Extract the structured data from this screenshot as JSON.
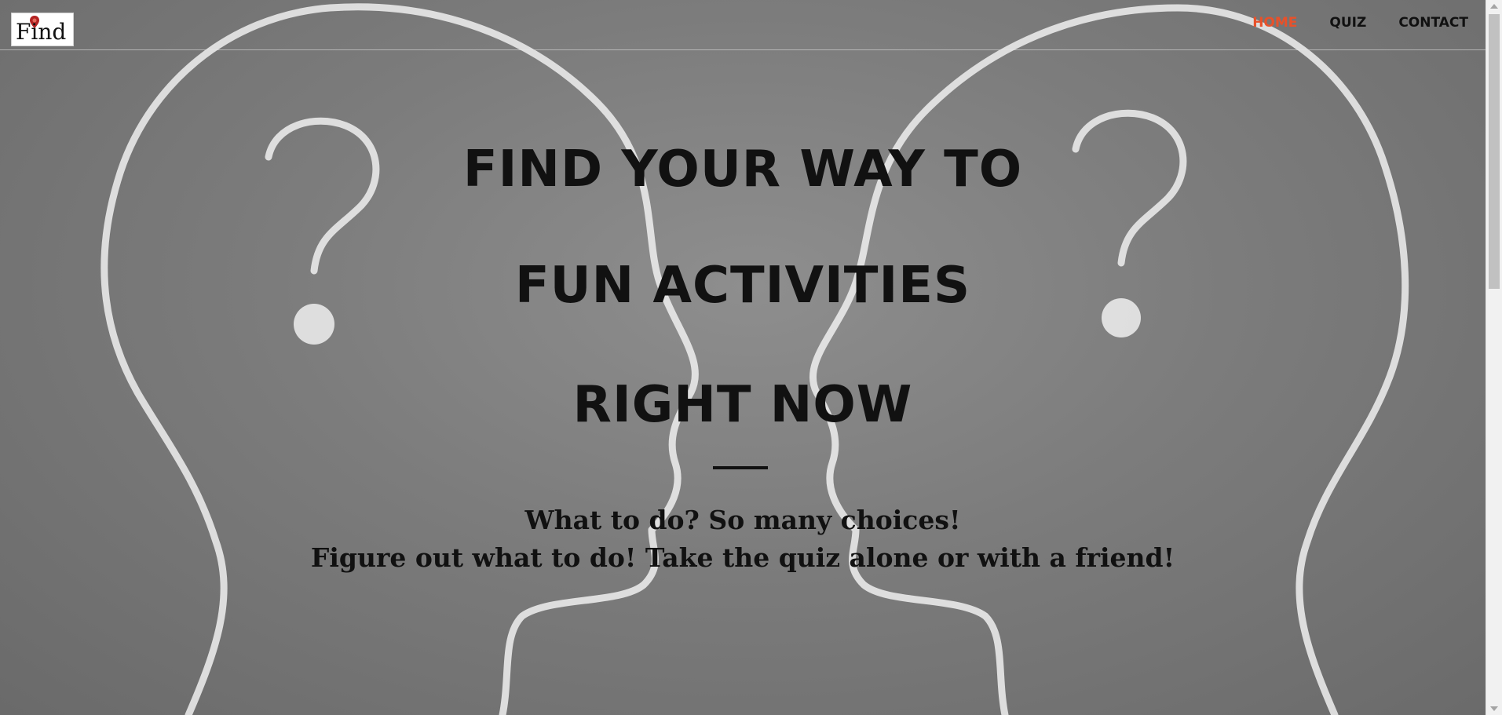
{
  "brand": {
    "logo_text": "Find",
    "pin_color": "#b32222"
  },
  "nav": {
    "items": [
      {
        "label": "HOME",
        "active": true
      },
      {
        "label": "QUIZ",
        "active": false
      },
      {
        "label": "CONTACT",
        "active": false
      }
    ],
    "active_color": "#e8512a"
  },
  "hero": {
    "headline_lines": [
      "FIND YOUR WAY TO",
      "FUN ACTIVITIES",
      "RIGHT NOW"
    ],
    "subtitle_lines": [
      "What to do? So many choices!",
      "Figure out what to do! Take the quiz alone or with a friend!"
    ]
  },
  "background": {
    "description_icon": "chalk-heads-question-marks",
    "chalk_color": "#f2f2f2",
    "board_color": "#7a7a7a"
  }
}
